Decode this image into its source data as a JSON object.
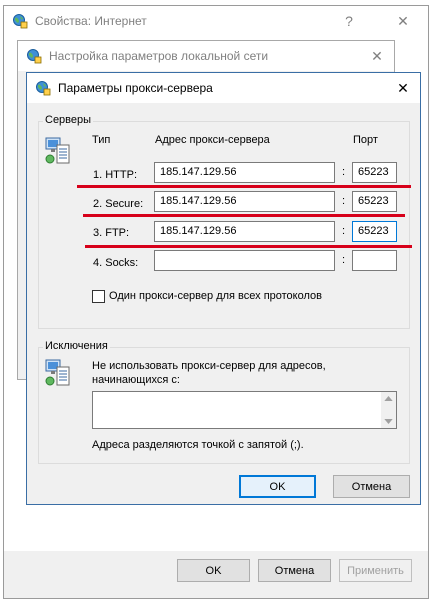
{
  "internet_properties": {
    "title": "Свойства: Интернет",
    "help": "?",
    "close": "✕",
    "ok": "OK",
    "cancel": "Отмена",
    "apply": "Применить"
  },
  "lan_settings": {
    "title": "Настройка параметров локальной сети",
    "close": "✕"
  },
  "proxy_dialog": {
    "title": "Параметры прокси-сервера",
    "close": "✕",
    "servers_group": "Серверы",
    "col_type": "Тип",
    "col_address": "Адрес прокси-сервера",
    "col_port": "Порт",
    "rows": [
      {
        "type": "1. HTTP:",
        "address": "185.147.129.56",
        "port": "65223"
      },
      {
        "type": "2. Secure:",
        "address": "185.147.129.56",
        "port": "65223"
      },
      {
        "type": "3. FTP:",
        "address": "185.147.129.56",
        "port": "65223"
      },
      {
        "type": "4. Socks:",
        "address": "",
        "port": ""
      }
    ],
    "separator": ":",
    "same_proxy_label": "Один прокси-сервер для всех протоколов",
    "same_proxy_checked": false,
    "exceptions_group": "Исключения",
    "exceptions_text": "Не использовать прокси-сервер для адресов, начинающихся с:",
    "exceptions_value": "",
    "exceptions_hint": "Адреса разделяются точкой с запятой (;).",
    "ok": "OK",
    "cancel": "Отмена"
  },
  "colors": {
    "accent": "#0078d7",
    "annotation_red": "#d7001a",
    "dialog_bg": "#f0f0f0"
  }
}
